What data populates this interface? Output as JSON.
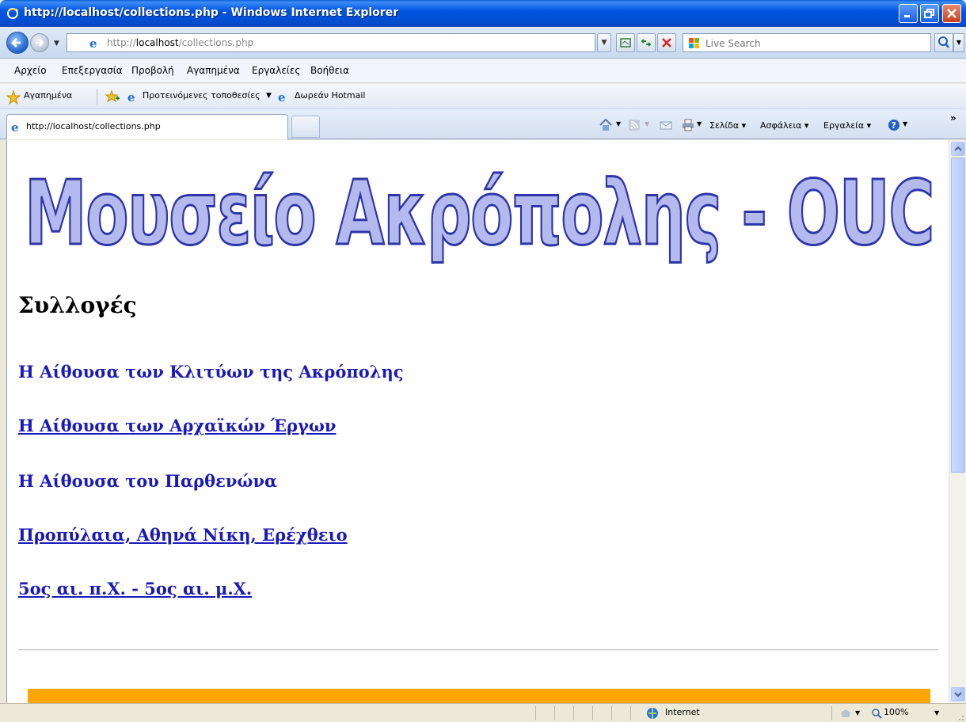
{
  "window": {
    "title": "http://localhost/collections.php - Windows Internet Explorer"
  },
  "address_bar": {
    "url_prefix": "http://",
    "url_host": "localhost",
    "url_path": "/collections.php",
    "search_placeholder": "Live Search"
  },
  "menu": {
    "items": [
      "Αρχείο",
      "Επεξεργασία",
      "Προβολή",
      "Αγαπημένα",
      "Εργαλείες",
      "Βοήθεια"
    ]
  },
  "favorites_bar": {
    "favorites_label": "Αγαπημένα",
    "suggested_sites_label": "Προτεινόμενες τοποθεσίες",
    "hotmail_label": "Δωρεάν Hotmail"
  },
  "tabs": {
    "active_tab_label": "http://localhost/collections.php"
  },
  "command_bar": {
    "page_label": "Σελίδα",
    "safety_label": "Ασφάλεια",
    "tools_label": "Εργαλεία",
    "more_label": "»"
  },
  "page": {
    "logo_text": "Μουσείο Ακρόπολης - OUC",
    "heading": "Συλλογές",
    "links": [
      "Η Αίθουσα των Κλιτύων της Ακρόπολης",
      "Η Αίθουσα των Αρχαϊκών Έργων",
      "Η Αίθουσα του Παρθενώνα",
      "Προπύλαια, Αθηνά Νίκη, Ερέχθειο",
      "5ος αι. π.Χ. - 5ος αι. μ.Χ."
    ],
    "accent_color": "#ffa500",
    "link_color": "#1a1ab8"
  },
  "status_bar": {
    "zone_label": "Internet",
    "zoom_label": "100%"
  }
}
